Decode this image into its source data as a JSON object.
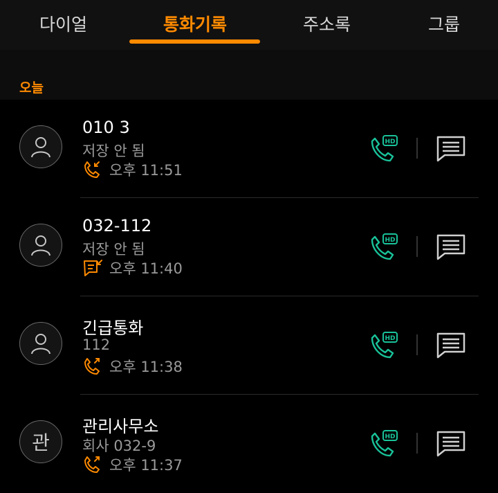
{
  "tabs": {
    "dial": "다이얼",
    "call_log": "통화기록",
    "contacts": "주소록",
    "groups": "그룹"
  },
  "section": {
    "today": "오늘"
  },
  "entries": [
    {
      "avatar_text": "",
      "name": "010 3",
      "sub": "저장 안 됨",
      "time": "오후 11:51",
      "call_type": "incoming-call-icon"
    },
    {
      "avatar_text": "",
      "name": "032-112",
      "sub": "저장 안 됨",
      "time": "오후 11:40",
      "call_type": "message-reply-icon"
    },
    {
      "avatar_text": "",
      "name": "긴급통화",
      "sub": "112",
      "time": "오후 11:38",
      "call_type": "outgoing-call-icon"
    },
    {
      "avatar_text": "관",
      "name": "관리사무소",
      "sub": "회사 032-9",
      "time": "오후 11:37",
      "call_type": "outgoing-call-icon"
    }
  ],
  "colors": {
    "accent": "#ff8a00",
    "hd_call": "#19c39a",
    "background": "#000000"
  }
}
